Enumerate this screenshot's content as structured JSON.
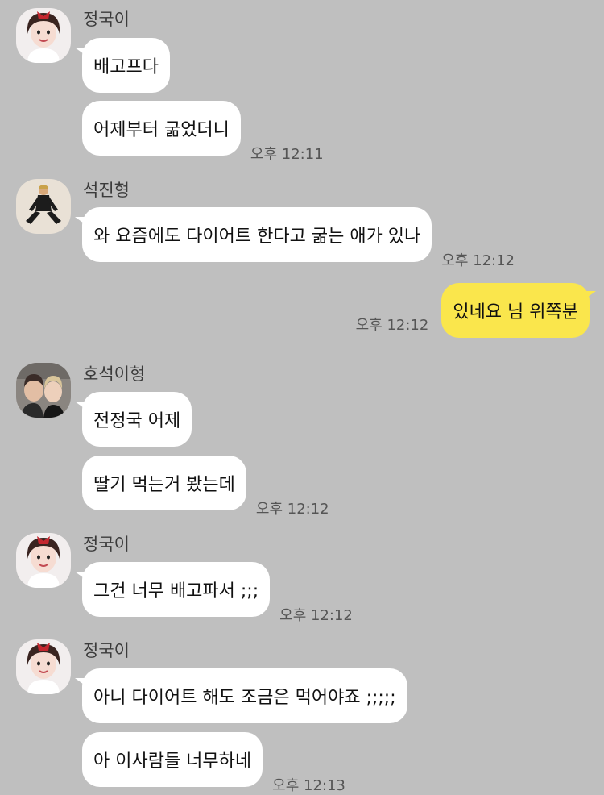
{
  "chat": {
    "groups": [
      {
        "sender": "정국이",
        "avatar_icon": "girl-profile-avatar",
        "messages": [
          "배고프다",
          "어제부터 굶었더니"
        ],
        "time": "오후 12:11"
      },
      {
        "sender": "석진형",
        "avatar_icon": "man-sitting-avatar",
        "messages": [
          "와 요즘에도 다이어트 한다고 굶는 애가 있나"
        ],
        "time": "오후 12:12"
      },
      {
        "me": true,
        "messages": [
          "있네요 님 위쪽분"
        ],
        "time": "오후 12:12"
      },
      {
        "sender": "호석이형",
        "avatar_icon": "two-people-selfie-avatar",
        "messages": [
          "전정국 어제",
          "딸기 먹는거 봤는데"
        ],
        "time": "오후 12:12"
      },
      {
        "sender": "정국이",
        "avatar_icon": "girl-profile-avatar",
        "messages": [
          "그건 너무 배고파서 ;;;"
        ],
        "time": "오후 12:12"
      },
      {
        "sender": "정국이",
        "avatar_icon": "girl-profile-avatar",
        "messages": [
          "아니 다이어트 해도 조금은 먹어야죠 ;;;;;",
          "아 이사람들 너무하네"
        ],
        "time": "오후 12:13"
      }
    ]
  },
  "colors": {
    "background": "#bfbfbf",
    "my_bubble": "#fae64c",
    "their_bubble": "#ffffff"
  }
}
